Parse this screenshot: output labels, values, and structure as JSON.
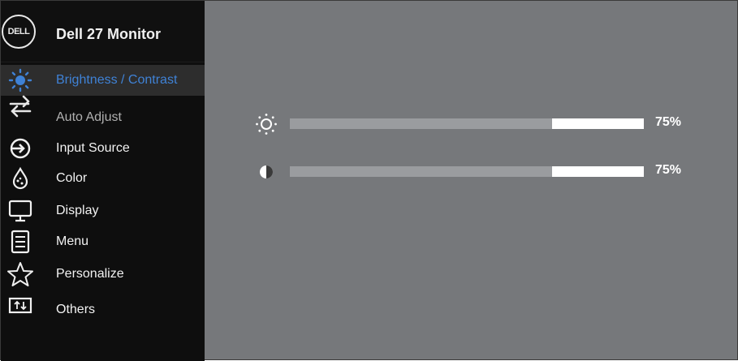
{
  "header": {
    "logo_text": "DELL",
    "title": "Dell 27 Monitor"
  },
  "sidebar": {
    "items": [
      {
        "label": "Brightness / Contrast",
        "icon": "brightness-icon",
        "state": "selected"
      },
      {
        "label": "Auto Adjust",
        "icon": "auto-adjust-icon",
        "state": "dimmed"
      },
      {
        "label": "Input Source",
        "icon": "input-source-icon",
        "state": "normal"
      },
      {
        "label": "Color",
        "icon": "color-icon",
        "state": "normal"
      },
      {
        "label": "Display",
        "icon": "display-icon",
        "state": "normal"
      },
      {
        "label": "Menu",
        "icon": "menu-icon",
        "state": "normal"
      },
      {
        "label": "Personalize",
        "icon": "star-icon",
        "state": "normal"
      },
      {
        "label": "Others",
        "icon": "others-icon",
        "state": "normal"
      }
    ]
  },
  "sliders": {
    "brightness": {
      "icon": "brightness-icon",
      "value": 75,
      "value_text": "75%"
    },
    "contrast": {
      "icon": "contrast-icon",
      "value": 75,
      "value_text": "75%"
    }
  },
  "colors": {
    "background": "#76787b",
    "sidebar": "#0e0e0e",
    "accent": "#3f82d6",
    "track": "#9a9c9f",
    "fill": "#ffffff"
  }
}
